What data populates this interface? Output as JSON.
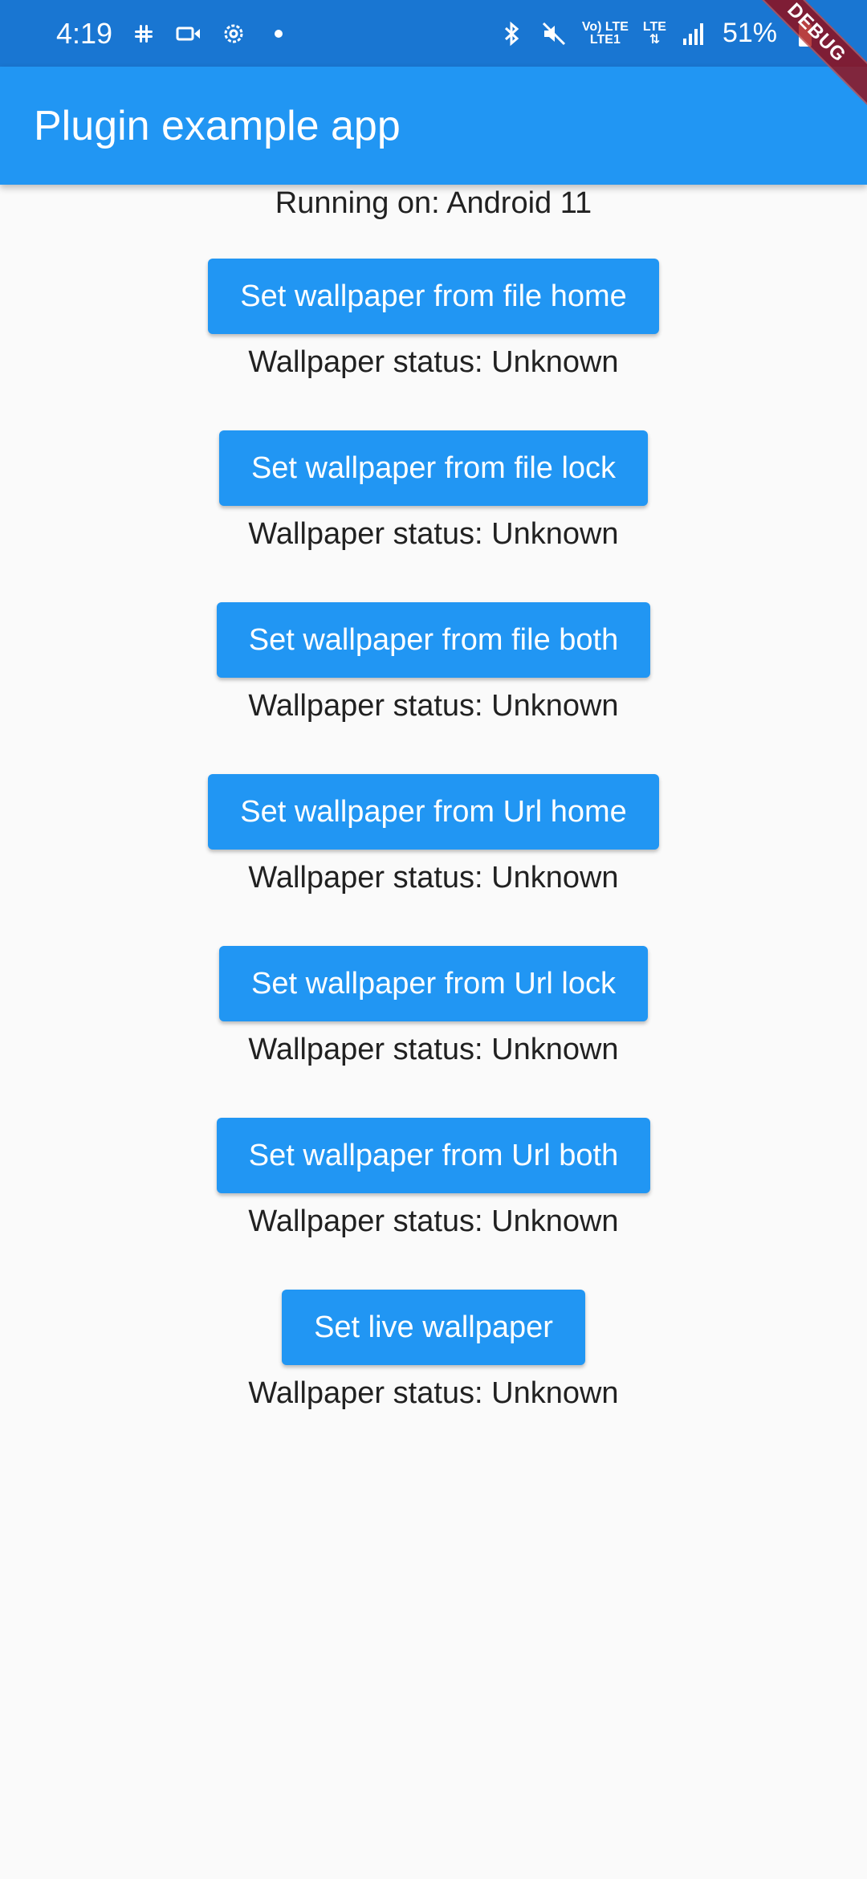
{
  "status_bar": {
    "time": "4:19",
    "lte_top": "Vo) LTE",
    "lte_bottom": "LTE1",
    "lte_label": "LTE",
    "battery": "51%",
    "icons": [
      "slack-icon",
      "video-camera-icon",
      "settings-gear-icon",
      "dot-icon",
      "bluetooth-icon",
      "mute-icon",
      "volte-icon",
      "signal-icon",
      "battery-icon"
    ]
  },
  "app_bar": {
    "title": "Plugin example app"
  },
  "debug_banner": {
    "label": "DEBUG"
  },
  "content": {
    "running_on": "Running on: Android 11",
    "items": [
      {
        "button": "Set wallpaper from file home",
        "status": "Wallpaper status: Unknown"
      },
      {
        "button": "Set wallpaper from file lock",
        "status": "Wallpaper status: Unknown"
      },
      {
        "button": "Set wallpaper from file both",
        "status": "Wallpaper status: Unknown"
      },
      {
        "button": "Set wallpaper from Url home",
        "status": "Wallpaper status: Unknown"
      },
      {
        "button": "Set wallpaper from Url lock",
        "status": "Wallpaper status: Unknown"
      },
      {
        "button": "Set wallpaper from Url both",
        "status": "Wallpaper status: Unknown"
      },
      {
        "button": "Set live wallpaper",
        "status": "Wallpaper status: Unknown"
      }
    ]
  },
  "colors": {
    "status_bar": "#1976d2",
    "app_bar": "#2196f3",
    "button": "#2196f3",
    "background": "#fafafa"
  }
}
